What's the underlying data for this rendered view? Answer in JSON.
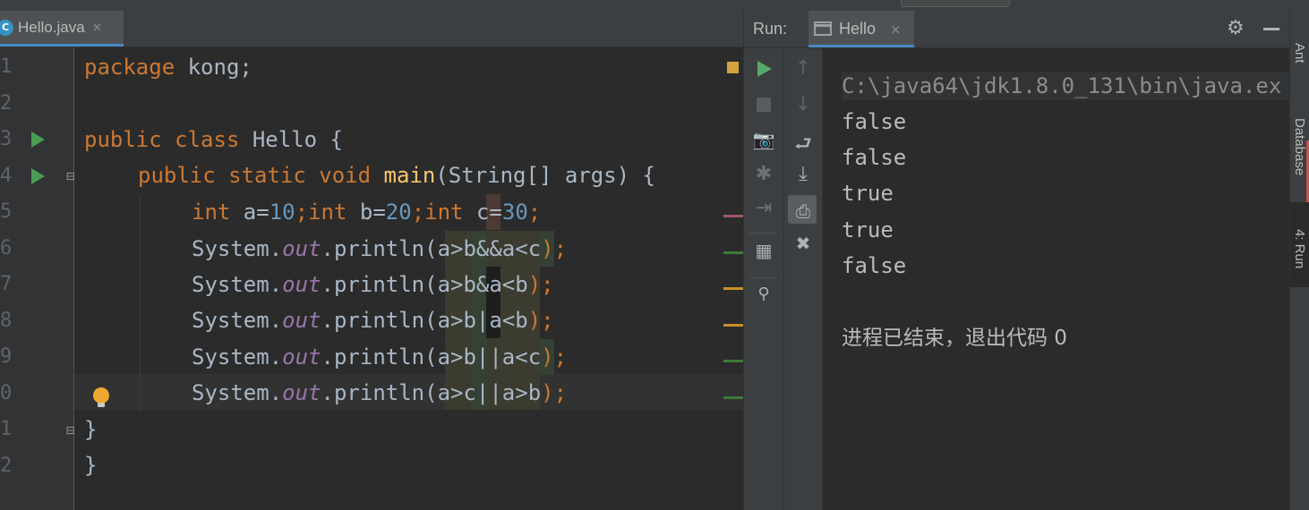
{
  "editor": {
    "file_tab": {
      "label": "Hello.java",
      "close": "×",
      "icon": "C"
    },
    "line_numbers": [
      "1",
      "2",
      "3",
      "4",
      "5",
      "6",
      "7",
      "8",
      "9",
      "0",
      "1",
      "2"
    ],
    "code": {
      "l1": {
        "kw": "package",
        "rest": " kong;"
      },
      "l3": {
        "kw": "public class",
        "name": " Hello {"
      },
      "l4": {
        "kw": "public static void",
        "fn": "main",
        "rest": "(String[] args) {"
      },
      "l5": {
        "kw1": "int",
        "a": " a=",
        "n1": "10",
        "s1": ";",
        "kw2": "int",
        "b": " b=",
        "n2": "20",
        "s2": ";",
        "kw3": "int",
        "c": " c=",
        "n3": "30",
        "s3": ";"
      },
      "sys": "System.",
      "out": "out",
      "println": ".println(",
      "end": ");",
      "exprs": [
        "a>b&&a<c",
        "a>b&a<b",
        "a>b|a<b",
        "a>b||a<c",
        "a>c||a>b"
      ],
      "close_brace": "}"
    }
  },
  "run": {
    "label": "Run:",
    "tab_label": "Hello",
    "tab_close": "×",
    "command": "C:\\java64\\jdk1.8.0_131\\bin\\java.ex",
    "outputs": [
      "false",
      "false",
      "true",
      "true",
      "false"
    ],
    "exit_message": "进程已结束，退出代码 0"
  },
  "right_strip": {
    "items": [
      "Ant",
      "Database",
      "4: Run"
    ]
  },
  "colors": {
    "keyword": "#cc7832",
    "number": "#6897bb",
    "field": "#9876aa",
    "function": "#ffc66d",
    "text": "#a9b7c6",
    "run_green": "#499c54"
  },
  "icons": {
    "gear": "⚙",
    "up": "↑",
    "down": "↓",
    "wrap": "⮐",
    "print": "🖶",
    "delete": "🗑",
    "pin": "📌",
    "camera": "📷",
    "bug": "✱"
  }
}
